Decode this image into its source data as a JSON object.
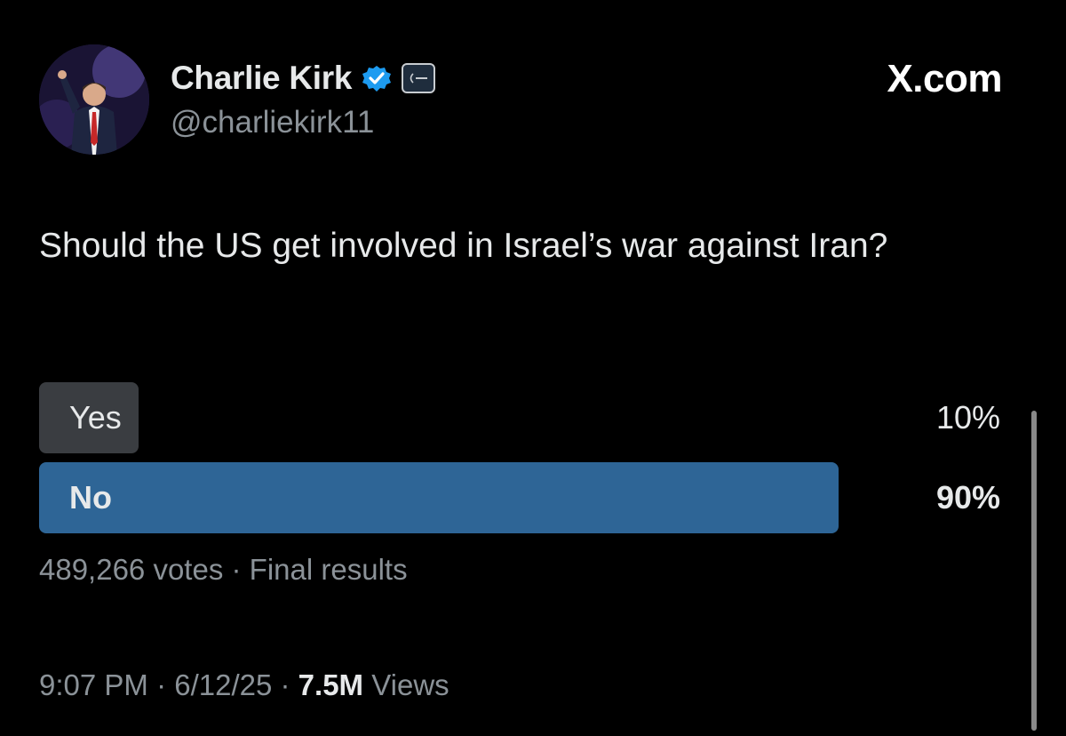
{
  "author": {
    "name": "Charlie Kirk",
    "handle": "@charliekirk11",
    "verified_icon": "verified-badge-icon",
    "affiliate_icon": "organization-affiliate-badge-icon"
  },
  "site_label": "X.com",
  "tweet": {
    "text": "Should the US get involved in Israel’s war against Iran?"
  },
  "poll": {
    "options": [
      {
        "label": "Yes",
        "percent": 10,
        "percent_text": "10%",
        "winner": false
      },
      {
        "label": "No",
        "percent": 90,
        "percent_text": "90%",
        "winner": true
      }
    ],
    "votes": "489,266 votes",
    "separator": " · ",
    "status": "Final results"
  },
  "footer": {
    "time": "9:07 PM",
    "date": "6/12/25",
    "views_count": "7.5M",
    "views_label": "Views",
    "separator": " · "
  },
  "colors": {
    "background": "#000000",
    "winner_bar": "#2e6596",
    "loser_bar": "#3a3d41",
    "verified": "#1d9bf0",
    "secondary_text": "#8b9298"
  }
}
